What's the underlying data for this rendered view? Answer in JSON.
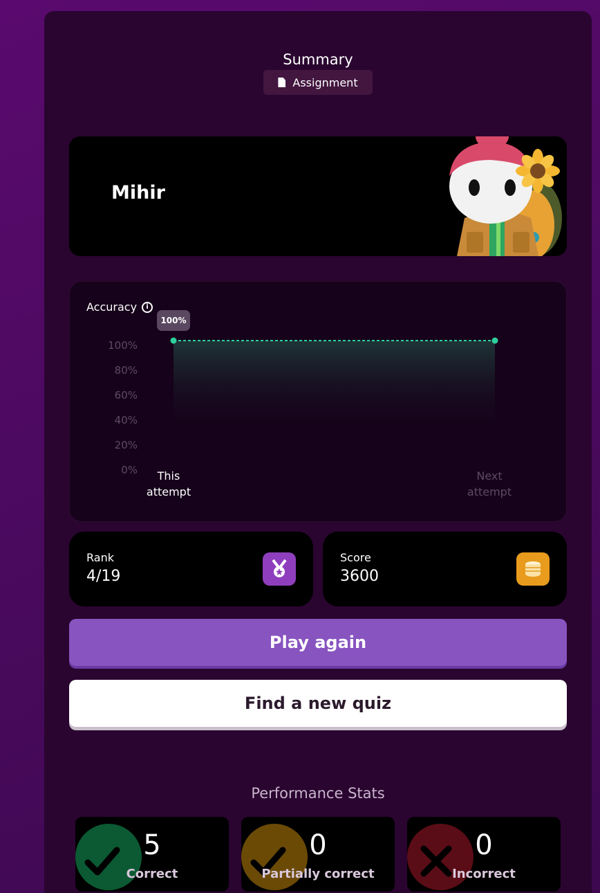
{
  "header": {
    "title": "Summary",
    "badge": "Assignment"
  },
  "player": {
    "name": "Mihir"
  },
  "accuracy": {
    "title": "Accuracy",
    "highlight": "100%"
  },
  "chart_data": {
    "type": "area",
    "title": "Accuracy",
    "categories": [
      "This attempt",
      "Next attempt"
    ],
    "series": [
      {
        "values": [
          100,
          100
        ]
      }
    ],
    "y_ticks": [
      "100%",
      "80%",
      "60%",
      "40%",
      "20%",
      "0%"
    ],
    "ylim": [
      0,
      100
    ],
    "data_label": "100%",
    "line_color": "#2ecf9c",
    "grid": false
  },
  "stats": {
    "rank": {
      "label": "Rank",
      "value": "4/19",
      "icon": "medal-icon",
      "color": "#8f3fbd"
    },
    "score": {
      "label": "Score",
      "value": "3600",
      "icon": "coins-icon",
      "color": "#e89b1c"
    }
  },
  "buttons": {
    "play_again": "Play again",
    "find_quiz": "Find a new quiz"
  },
  "performance": {
    "title": "Performance Stats",
    "items": [
      {
        "value": "5",
        "label": "Correct",
        "color": "#0b5a33"
      },
      {
        "value": "0",
        "label": "Partially correct",
        "color": "#6b4a06"
      },
      {
        "value": "0",
        "label": "Incorrect",
        "color": "#5a0d16"
      }
    ]
  }
}
